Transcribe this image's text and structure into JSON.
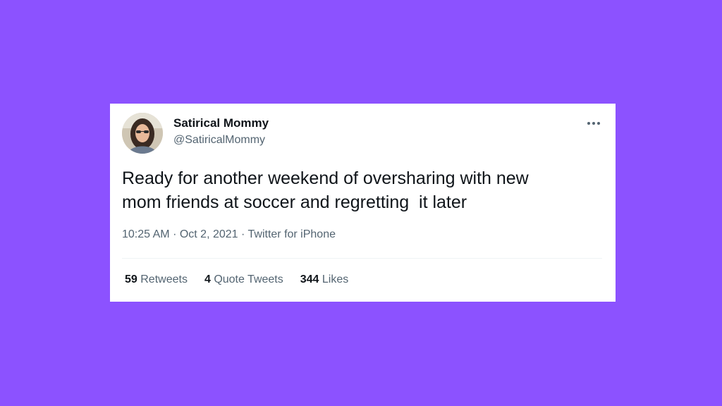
{
  "colors": {
    "background": "#8c52ff",
    "card": "#ffffff",
    "text_primary": "#0f1419",
    "text_secondary": "#536471"
  },
  "tweet": {
    "author": {
      "name": "Satirical Mommy",
      "handle": "@SatiricalMommy",
      "avatar_icon": "profile-photo"
    },
    "more_icon": "more-horizontal-icon",
    "text": "Ready for another weekend of oversharing with new\nmom friends at soccer and regretting  it later",
    "time": "10:25 AM",
    "date": "Oct 2, 2021",
    "source": "Twitter for iPhone",
    "separator": "·",
    "stats": [
      {
        "count": "59",
        "label": "Retweets"
      },
      {
        "count": "4",
        "label": "Quote Tweets"
      },
      {
        "count": "344",
        "label": "Likes"
      }
    ]
  }
}
